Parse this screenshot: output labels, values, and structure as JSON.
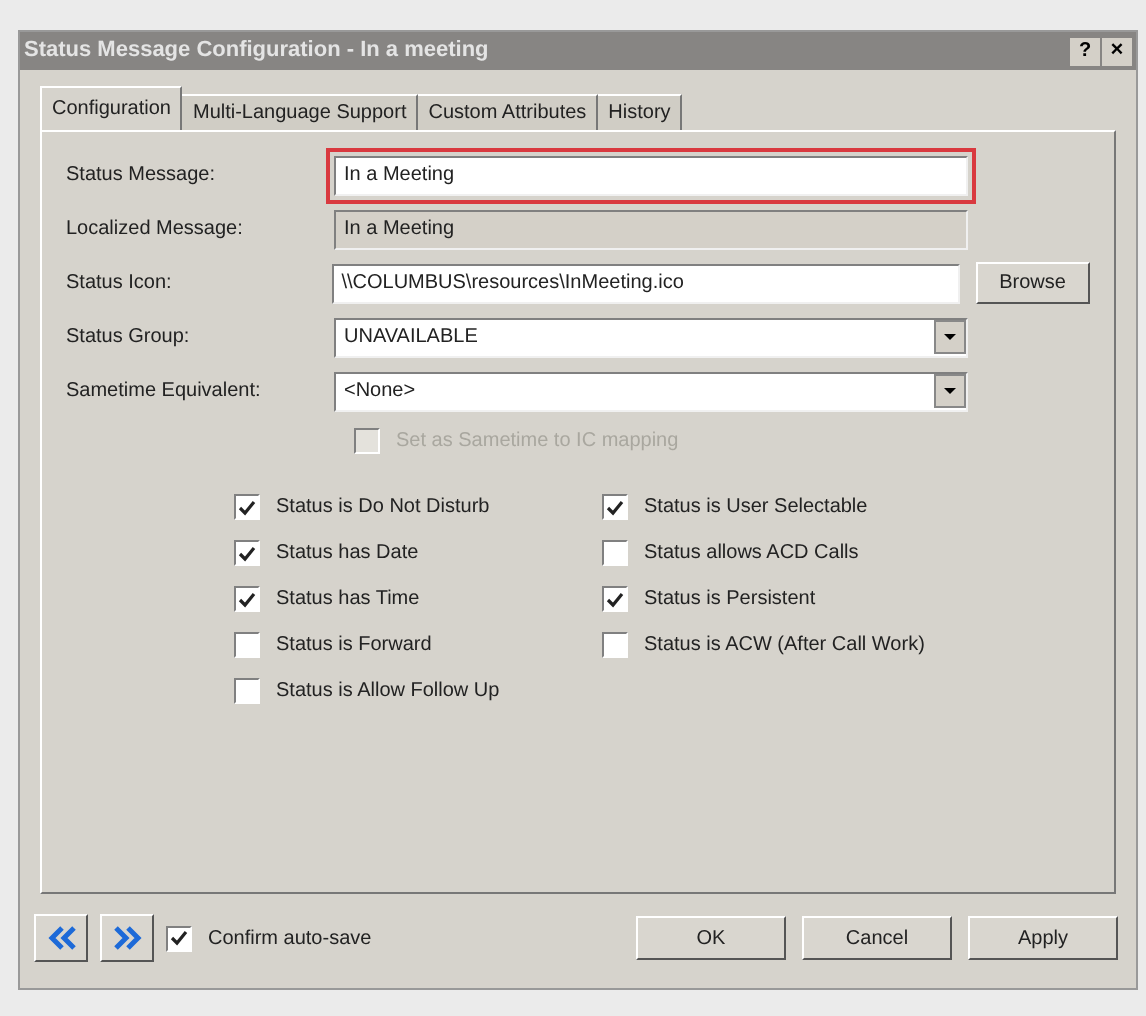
{
  "window": {
    "title": "Status Message Configuration - In a meeting",
    "help_button": "?",
    "close_button": "×"
  },
  "tabs": [
    {
      "label": "Configuration",
      "selected": true
    },
    {
      "label": "Multi-Language Support",
      "selected": false
    },
    {
      "label": "Custom Attributes",
      "selected": false
    },
    {
      "label": "History",
      "selected": false
    }
  ],
  "fields": [
    {
      "label": "Status Message:",
      "kind": "text",
      "value": "In a Meeting",
      "highlighted": true
    },
    {
      "label": "Localized Message:",
      "kind": "readonly",
      "value": "In a Meeting",
      "highlighted": false
    },
    {
      "label": "Status Icon:",
      "kind": "file",
      "value": "\\\\COLUMBUS\\resources\\InMeeting.ico",
      "button": "Browse",
      "highlighted": false
    },
    {
      "label": "Status Group:",
      "kind": "select",
      "value": "UNAVAILABLE",
      "highlighted": false
    },
    {
      "label": "Sametime Equivalent:",
      "kind": "select",
      "value": "<None>",
      "highlighted": false
    }
  ],
  "mapping_option": {
    "label": "Set as Sametime to IC mapping",
    "checked": false,
    "disabled": true
  },
  "options_left": [
    {
      "label": "Status is Do Not Disturb",
      "checked": true
    },
    {
      "label": "Status has Date",
      "checked": true
    },
    {
      "label": "Status has Time",
      "checked": true
    },
    {
      "label": "Status is Forward",
      "checked": false
    },
    {
      "label": "Status is Allow Follow Up",
      "checked": false
    }
  ],
  "options_right": [
    {
      "label": "Status is User Selectable",
      "checked": true
    },
    {
      "label": "Status allows ACD Calls",
      "checked": false
    },
    {
      "label": "Status is Persistent",
      "checked": true
    },
    {
      "label": "Status is ACW (After Call Work)",
      "checked": false
    }
  ],
  "confirm_autosave": {
    "label": "Confirm auto-save",
    "checked": true
  },
  "buttons": [
    "OK",
    "Cancel",
    "Apply"
  ]
}
